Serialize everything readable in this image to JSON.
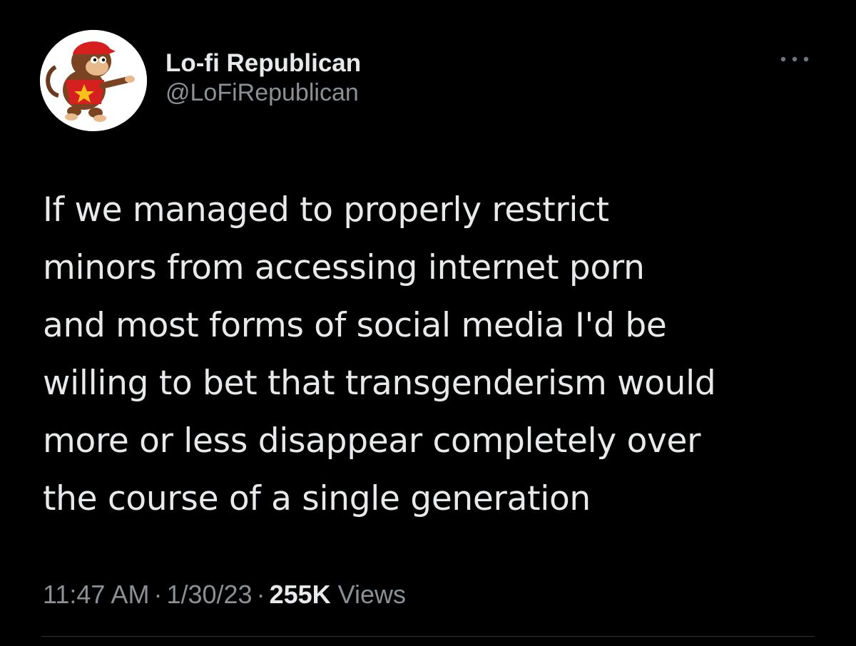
{
  "author": {
    "display_name": "Lo-fi Republican",
    "handle": "@LoFiRepublican",
    "avatar_icon": "avatar-monkey-character-icon"
  },
  "more_icon": "more-options-dots-icon",
  "tweet": {
    "lines": [
      "If we managed to properly restrict",
      "minors from accessing internet porn",
      "and most forms of social media I'd be",
      "willing to bet that transgenderism would",
      "more or less disappear completely over",
      "the course of a single generation"
    ]
  },
  "meta": {
    "time": "11:47 AM",
    "separator": "·",
    "date": "1/30/23",
    "views_count": "255K",
    "views_label": "Views"
  },
  "colors": {
    "background": "#000000",
    "primary_text": "#e7e9ea",
    "secondary_text": "#8b9095",
    "divider": "#2f3336"
  }
}
